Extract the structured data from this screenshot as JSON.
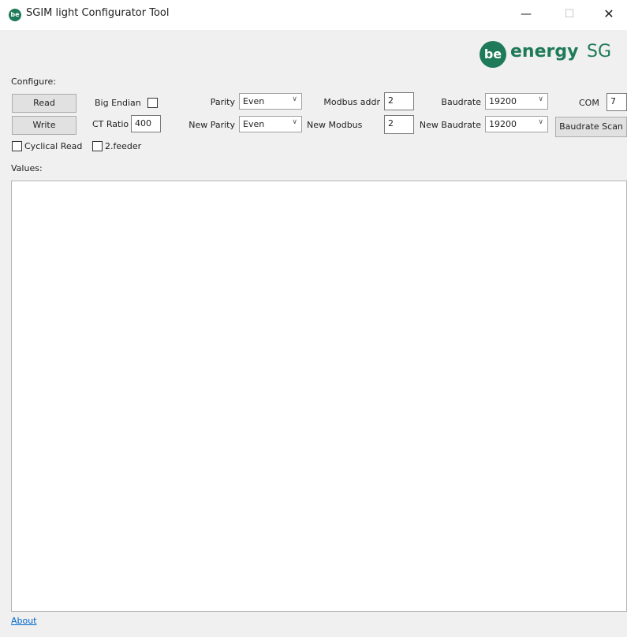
{
  "window": {
    "title": "SGIM light Configurator Tool",
    "icon_text": "be",
    "minimize_glyph": "—",
    "maximize_glyph": "☐",
    "close_glyph": "✕"
  },
  "logo": {
    "circle_text": "be",
    "word": "energy",
    "suffix": "SG"
  },
  "configure": {
    "section_label": "Configure:",
    "read_button": "Read",
    "write_button": "Write",
    "big_endian_label": "Big Endian",
    "ct_ratio_label": "CT Ratio",
    "ct_ratio_value": "400",
    "cyclical_read_label": "Cyclical Read",
    "feeder_label": "2.feeder",
    "parity_label": "Parity",
    "parity_value": "Even",
    "new_parity_label": "New Parity",
    "new_parity_value": "Even",
    "modbus_addr_label": "Modbus addr",
    "modbus_addr_value": "2",
    "new_modbus_label": "New Modbus",
    "new_modbus_value": "2",
    "baudrate_label": "Baudrate",
    "baudrate_value": "19200",
    "new_baudrate_label": "New Baudrate",
    "new_baudrate_value": "19200",
    "com_label": "COM",
    "com_value": "7",
    "baudrate_scan_button": "Baudrate Scan"
  },
  "values": {
    "label": "Values:"
  },
  "footer": {
    "about_link": "About"
  },
  "colors": {
    "brand_green": "#1e7a58",
    "link_blue": "#0066cc"
  }
}
